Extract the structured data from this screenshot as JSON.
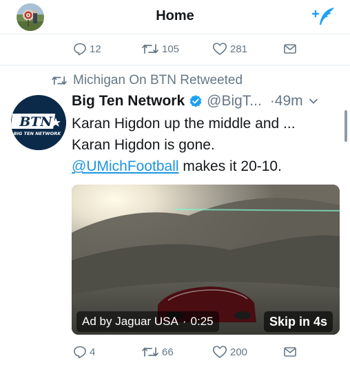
{
  "header": {
    "title": "Home",
    "avatar_icon": "profile-photo",
    "compose_icon": "compose-feather-icon",
    "accent": "#1da1f2"
  },
  "top_actions": {
    "replies": "12",
    "retweets": "105",
    "likes": "281"
  },
  "tweet": {
    "retweet_context": "Michigan On BTN Retweeted",
    "author_name": "Big Ten Network",
    "handle": "@BigT...",
    "time": "·49m",
    "avatar_text": "BTN",
    "avatar_subtext": "BIG TEN NETWORK",
    "text_line1": "Karan Higdon up the middle and ...",
    "text_line2": "Karan Higdon is gone.",
    "mention": "@UMichFootball",
    "text_line3_rest": " makes it 20-10.",
    "media": {
      "ad_label": "Ad by Jaguar USA",
      "separator": "·",
      "duration": "0:25",
      "skip_label": "Skip in 4s"
    },
    "actions": {
      "replies": "4",
      "retweets": "66",
      "likes": "200"
    }
  }
}
